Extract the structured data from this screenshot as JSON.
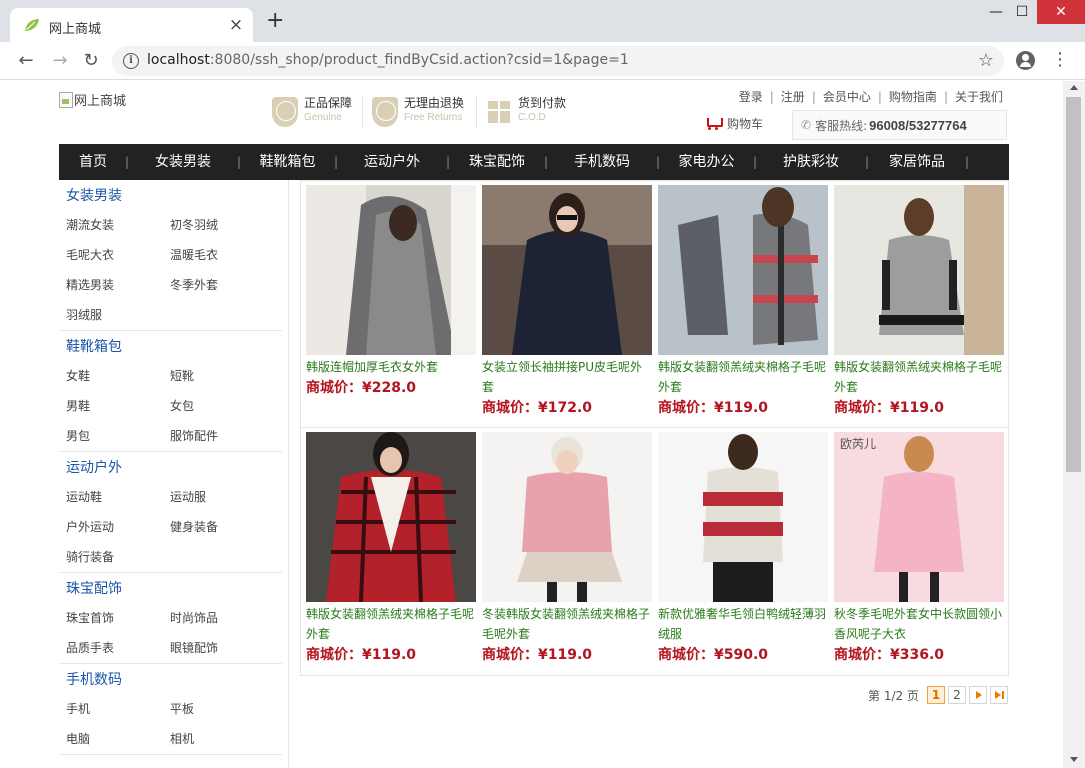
{
  "browser": {
    "tab_title": "网上商城",
    "url_host": "localhost",
    "url_rest": ":8080/ssh_shop/product_findByCsid.action?csid=1&page=1"
  },
  "header": {
    "logo_alt": "网上商城",
    "promises": [
      {
        "title": "正品保障",
        "sub": "Genuine",
        "icon": "genuine-shield-icon"
      },
      {
        "title": "无理由退换",
        "sub": "Free Returns",
        "icon": "returns-shield-icon"
      },
      {
        "title": "货到付款",
        "sub": "C.O.D",
        "icon": "gift-box-icon"
      }
    ],
    "top_links": [
      "登录",
      "注册",
      "会员中心",
      "购物指南",
      "关于我们"
    ],
    "cart_label": "购物车",
    "hotline_label": "客服热线:",
    "hotline_number": "96008/53277764"
  },
  "nav": [
    "首页",
    "女装男装",
    "鞋靴箱包",
    "运动户外",
    "珠宝配饰",
    "手机数码",
    "家电办公",
    "护肤彩妆",
    "家居饰品"
  ],
  "sidebar": [
    {
      "title": "女装男装",
      "subs": [
        "潮流女装",
        "初冬羽绒",
        "毛呢大衣",
        "温暖毛衣",
        "精选男装",
        "冬季外套",
        "羽绒服"
      ]
    },
    {
      "title": "鞋靴箱包",
      "subs": [
        "女鞋",
        "短靴",
        "男鞋",
        "女包",
        "男包",
        "服饰配件"
      ]
    },
    {
      "title": "运动户外",
      "subs": [
        "运动鞋",
        "运动服",
        "户外运动",
        "健身装备",
        "骑行装备"
      ]
    },
    {
      "title": "珠宝配饰",
      "subs": [
        "珠宝首饰",
        "时尚饰品",
        "品质手表",
        "眼镜配饰"
      ]
    },
    {
      "title": "手机数码",
      "subs": [
        "手机",
        "平板",
        "电脑",
        "相机"
      ]
    }
  ],
  "price_label": "商城价：",
  "products": [
    {
      "name": "韩版连帽加厚毛衣女外套",
      "price": "¥228.0"
    },
    {
      "name": "女装立领长袖拼接PU皮毛呢外套",
      "price": "¥172.0"
    },
    {
      "name": "韩版女装翻领羔绒夹棉格子毛呢外套",
      "price": "¥119.0"
    },
    {
      "name": "韩版女装翻领羔绒夹棉格子毛呢外套",
      "price": "¥119.0"
    },
    {
      "name": "韩版女装翻领羔绒夹棉格子毛呢外套",
      "price": "¥119.0"
    },
    {
      "name": "冬装韩版女装翻领羔绒夹棉格子毛呢外套",
      "price": "¥119.0"
    },
    {
      "name": "新款优雅奢华毛领白鸭绒轻薄羽绒服",
      "price": "¥590.0"
    },
    {
      "name": "秋冬季毛呢外套女中长款圆领小香风呢子大衣",
      "price": "¥336.0"
    }
  ],
  "product_image_watermark": "欧芮儿",
  "pager": {
    "info": "第 1/2 页",
    "pages": [
      "1",
      "2"
    ],
    "current": "1"
  },
  "colors": {
    "nav_bg": "#222222",
    "category_blue": "#1d56a8",
    "product_green": "#2a7a1c",
    "price_red": "#b3141d",
    "pager_orange": "#f07a00"
  }
}
